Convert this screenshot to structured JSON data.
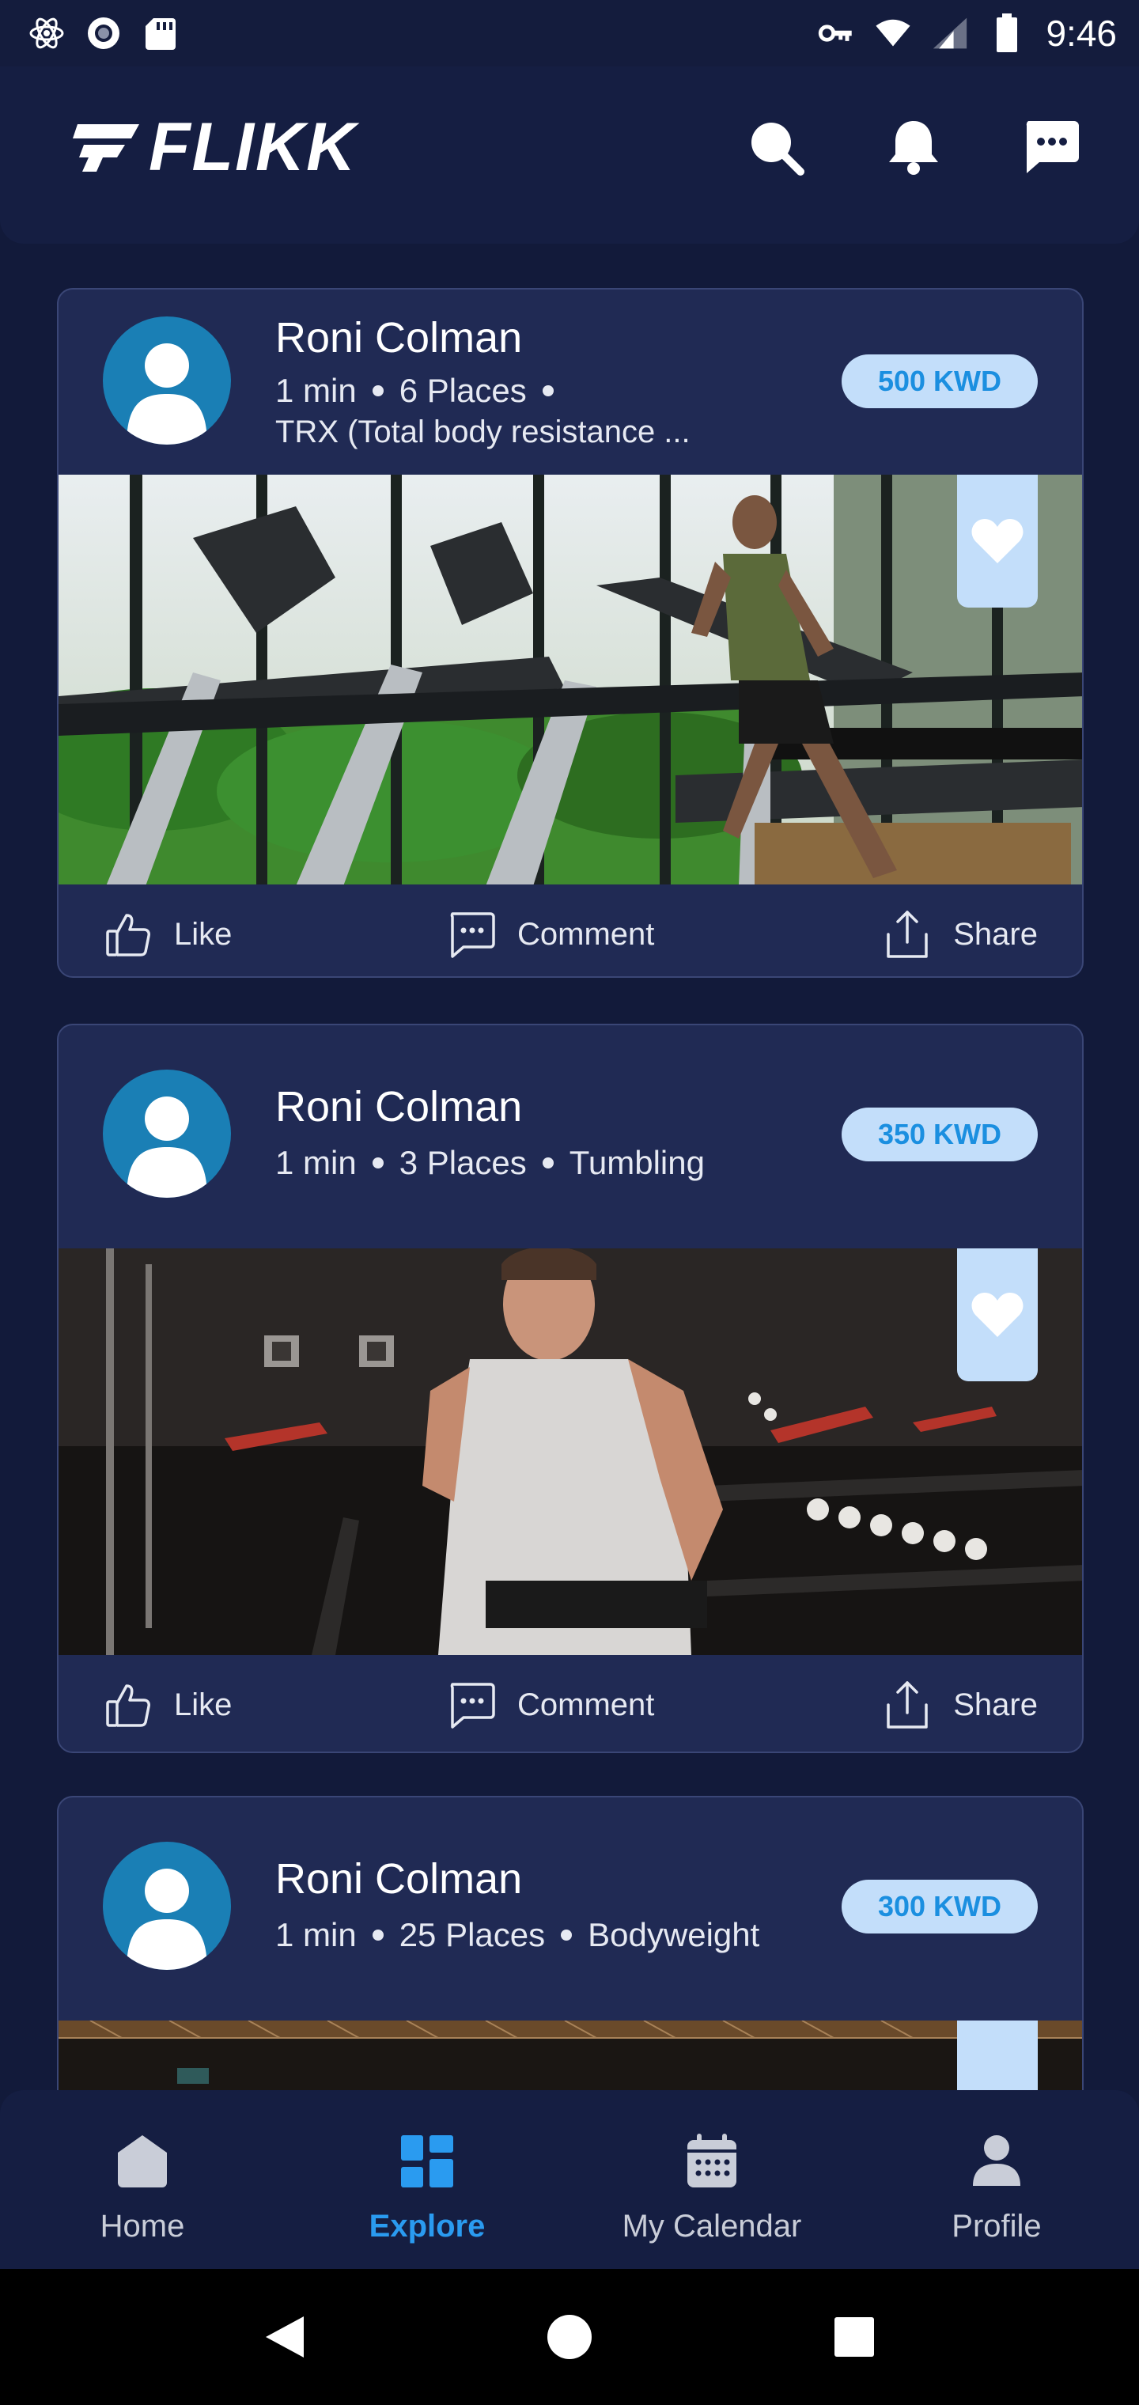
{
  "status_bar": {
    "time": "9:46",
    "left_icons": [
      "react-icon",
      "record-icon",
      "sd-card-icon"
    ],
    "right_icons": [
      "vpn-key-icon",
      "wifi-icon",
      "signal-icon",
      "battery-icon"
    ]
  },
  "header": {
    "logo_text": "FLIKK",
    "actions": [
      "search-icon",
      "bell-icon",
      "chat-icon"
    ]
  },
  "posts": [
    {
      "name": "Roni Colman",
      "duration": "1 min",
      "places": "6 Places",
      "category": "",
      "description": "TRX (Total body resistance ...",
      "price": "500 KWD",
      "image": "treadmill-gym-photo"
    },
    {
      "name": "Roni Colman",
      "duration": "1 min",
      "places": "3 Places",
      "category": "Tumbling",
      "description": "",
      "price": "350 KWD",
      "image": "bodybuilder-gym-photo"
    },
    {
      "name": "Roni Colman",
      "duration": "1 min",
      "places": "25 Places",
      "category": "Bodyweight",
      "description": "",
      "price": "300 KWD",
      "image": "gym-ceiling-photo"
    }
  ],
  "post_actions": {
    "like": "Like",
    "comment": "Comment",
    "share": "Share"
  },
  "bottom_nav": {
    "items": [
      {
        "label": "Home",
        "icon": "home-icon",
        "active": false
      },
      {
        "label": "Explore",
        "icon": "grid-icon",
        "active": true
      },
      {
        "label": "My Calendar",
        "icon": "calendar-icon",
        "active": false
      },
      {
        "label": "Profile",
        "icon": "person-icon",
        "active": false
      }
    ]
  },
  "colors": {
    "background": "#121a3a",
    "card": "#202a54",
    "accent": "#2a9bf0",
    "badge_bg": "#c3defa",
    "badge_text": "#1b8fe0",
    "avatar": "#1a7fb5"
  }
}
